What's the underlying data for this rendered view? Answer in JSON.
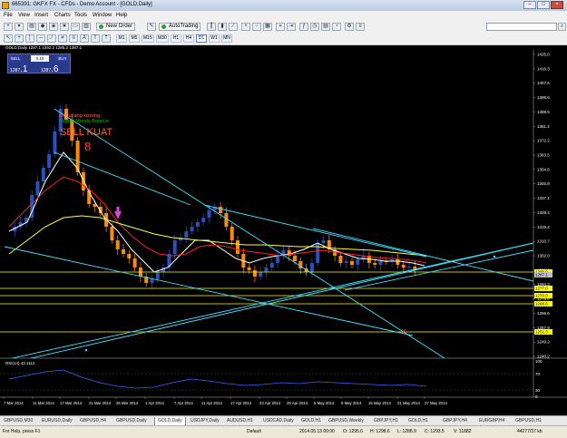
{
  "window": {
    "title": "665391: GKFX FX - CFDs - Demo Account - [GOLD,Daily]",
    "min": "–",
    "max": "□",
    "close": "×"
  },
  "menu": [
    "File",
    "View",
    "Insert",
    "Charts",
    "Tools",
    "Window",
    "Help"
  ],
  "toolbar": {
    "new_order": "New Order",
    "autotrading": "AutoTrading",
    "timeframes": [
      "M1",
      "M5",
      "M15",
      "M30",
      "H1",
      "H4",
      "D1",
      "W1",
      "MN"
    ]
  },
  "chart": {
    "header": "GOLD,Daily  1287.1 1292.2 1285.2 1287.1",
    "trade_panel": {
      "sell": "SELL",
      "buy": "BUY",
      "lot": "0.10",
      "bid_prefix": "1287",
      "bid_suffix": ".1",
      "ask_prefix": "1287",
      "ask_suffix": ".6"
    },
    "annotations": {
      "legend_red": "Sr. lubang kosong",
      "legend_green": "Yellow Moody Bounce",
      "sell_text": "SELL KUAT"
    },
    "price_axis": [
      "1425.0",
      "1416.3",
      "1407.6",
      "1398.6",
      "1389.9",
      "1381.2",
      "1372.2",
      "1363.5",
      "1354.8",
      "1345.8",
      "1337.1",
      "1328.4",
      "1319.4",
      "1310.7",
      "1302.0",
      "1293.0",
      "1284.3",
      "1275.6",
      "1266.6",
      "1257.9",
      "1249.2",
      "1240.2"
    ],
    "price_tags": [
      {
        "label": "1289.0",
        "color": "#ffff00"
      },
      {
        "label": "1287.1",
        "color": "#c0c0c0"
      },
      {
        "label": "1277.0",
        "color": "#ffff00"
      },
      {
        "label": "1273.0",
        "color": "#ffff00"
      },
      {
        "label": "1268.6",
        "color": "#ffff00"
      },
      {
        "label": "1251.3",
        "color": "#ffff00"
      }
    ],
    "date_axis": [
      "7 Mar 2014",
      "11 Mar 2014",
      "17 Mar 2014",
      "21 Mar 2014",
      "26 Mar 2014",
      "1 Apr 2014",
      "7 Apr 2014",
      "11 Apr 2014",
      "17 Apr 2014",
      "23 Apr 2014",
      "29 Apr 2014",
      "5 May 2014",
      "9 May 2014",
      "15 May 2014",
      "21 May 2014",
      "27 May 2014"
    ],
    "rsi": {
      "label": "RSI(14) 43.1112",
      "levels": [
        "100",
        "70",
        "30",
        "0"
      ]
    },
    "colors": {
      "background": "#000000",
      "bull": "#2a52be",
      "bear": "#ff8c00",
      "ma_fast": "#ffffff",
      "ma_mid": "#ff2020",
      "ma_slow": "#ffff40",
      "trendline": "#40e0ff",
      "level": "#ffff00"
    }
  },
  "tabs": [
    "GBPUSD,M30",
    "EURUSD,Daily",
    "GBPUSD,H4",
    "GBPUSD,Daily",
    "GOLD,Daily",
    "USDJPY,Daily",
    "AUDUSD,H1",
    "USDCAD,Daily",
    "GOLD,H1",
    "GBPUSD,Weekly",
    "GBPJPY,H1",
    "GOLD,H1",
    "GBPJPY,H4",
    "EURGBP,H4",
    "GBPUSD,H1"
  ],
  "active_tab": "GOLD,Daily",
  "status": {
    "help": "For Help, press F1",
    "profile": "Default",
    "datetime": "2014.05.13 00:00",
    "open": "O: 1295.6",
    "high": "H: 1298.6",
    "low": "L: 1288.9",
    "close": "C: 1293.5",
    "volume": "V: 11882",
    "traffic": "44277/37 kb"
  }
}
